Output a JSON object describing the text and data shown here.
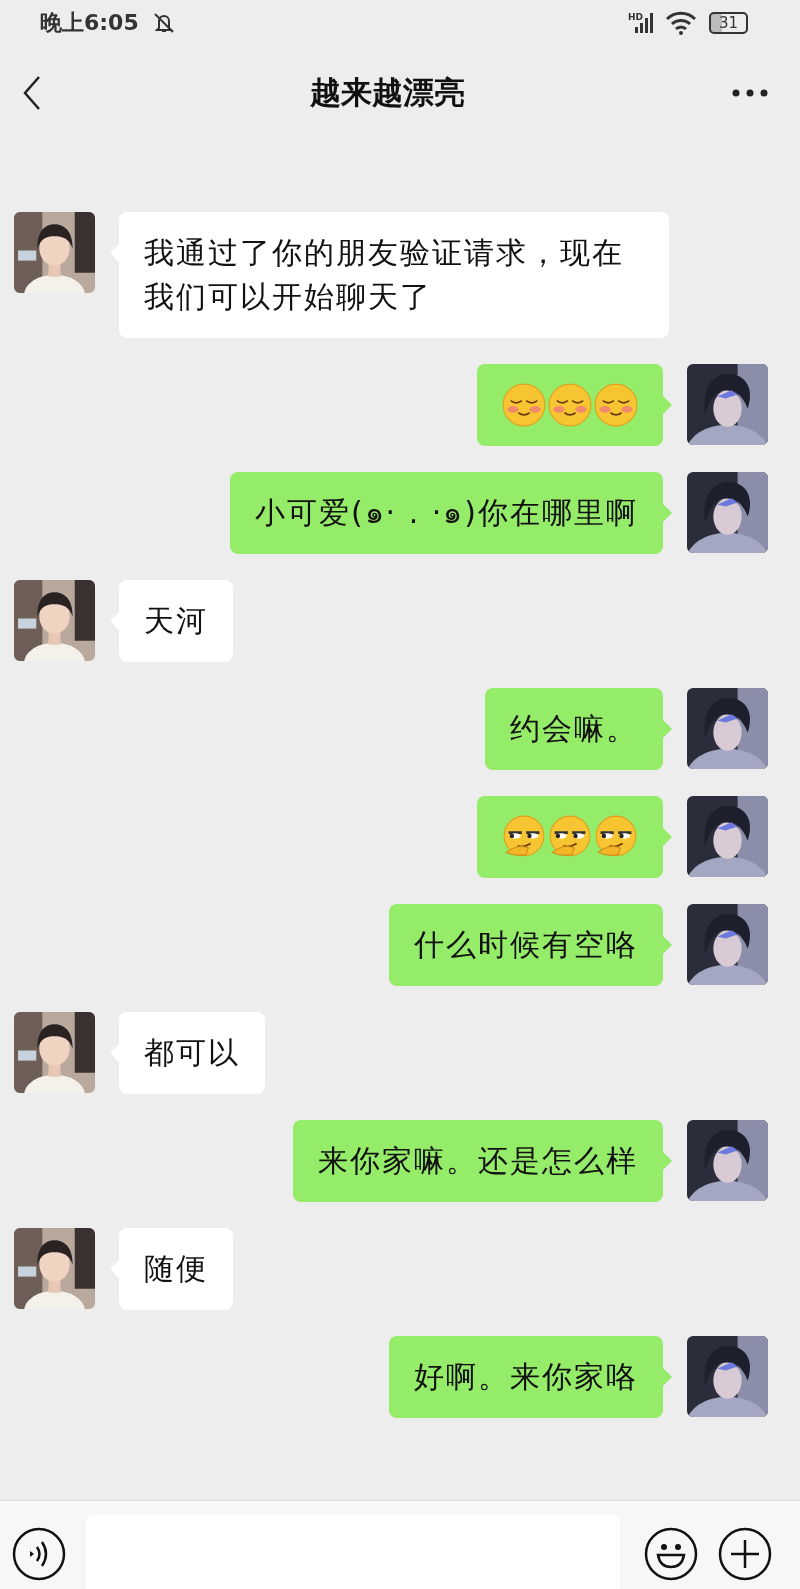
{
  "status_bar": {
    "time": "晚上6:05",
    "network": "HD",
    "battery": "31"
  },
  "header": {
    "title": "越来越漂亮"
  },
  "messages": [
    {
      "outgoing": false,
      "kind": "text",
      "text": "我通过了你的朋友验证请求，现在我们可以开始聊天了"
    },
    {
      "outgoing": true,
      "kind": "emoji",
      "emojis": [
        {
          "kind": "blush"
        },
        {
          "kind": "blush"
        },
        {
          "kind": "blush"
        }
      ]
    },
    {
      "outgoing": true,
      "kind": "text",
      "text": "小可爱(๑· . ·๑)你在哪里啊"
    },
    {
      "outgoing": false,
      "kind": "text",
      "text": "天河"
    },
    {
      "outgoing": true,
      "kind": "text",
      "text": "约会嘛。"
    },
    {
      "outgoing": true,
      "kind": "emoji",
      "emojis": [
        {
          "kind": "smirk"
        },
        {
          "kind": "smirk"
        },
        {
          "kind": "smirk"
        }
      ]
    },
    {
      "outgoing": true,
      "kind": "text",
      "text": "什么时候有空咯"
    },
    {
      "outgoing": false,
      "kind": "text",
      "text": "都可以"
    },
    {
      "outgoing": true,
      "kind": "text",
      "text": "来你家嘛。还是怎么样"
    },
    {
      "outgoing": false,
      "kind": "text",
      "text": "随便"
    },
    {
      "outgoing": true,
      "kind": "text",
      "text": "好啊。来你家咯"
    }
  ]
}
